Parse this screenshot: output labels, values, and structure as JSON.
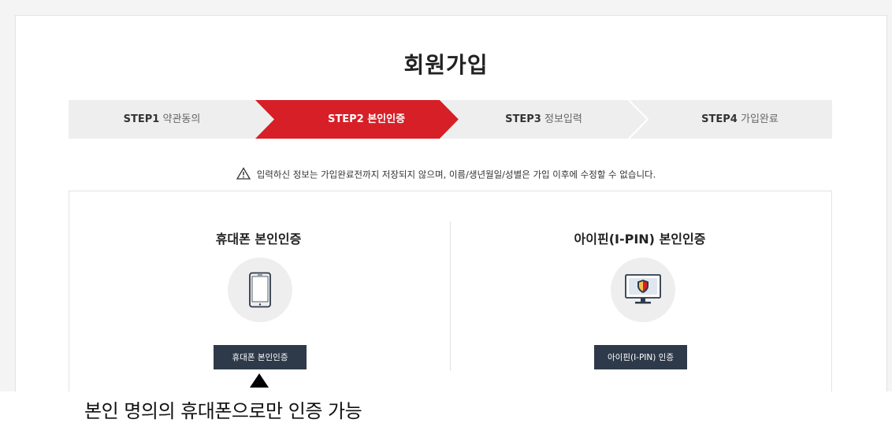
{
  "title": "회원가입",
  "steps": [
    {
      "num": "STEP1",
      "label": "약관동의",
      "active": false
    },
    {
      "num": "STEP2",
      "label": "본인인증",
      "active": true
    },
    {
      "num": "STEP3",
      "label": "정보입력",
      "active": false
    },
    {
      "num": "STEP4",
      "label": "가입완료",
      "active": false
    }
  ],
  "notice": "입력하신 정보는 가입완료전까지 저장되지 않으며, 이름/생년월일/성별은 가입 이후에 수정할 수 없습니다.",
  "auth": {
    "phone": {
      "title": "휴대폰 본인인증",
      "button": "휴대폰 본인인증",
      "icon": "smartphone-icon"
    },
    "ipin": {
      "title": "아이핀(I-PIN) 본인인증",
      "button": "아이핀(I-PIN) 인증",
      "icon": "monitor-shield-icon"
    }
  },
  "annotation": "본인 명의의 휴대폰으로만 인증 가능",
  "colors": {
    "active_step": "#d71f27",
    "inactive_step": "#eeeeee",
    "button": "#2e3a4a"
  }
}
